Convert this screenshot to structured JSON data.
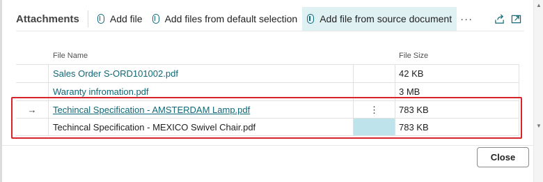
{
  "toolbar": {
    "title": "Attachments",
    "add_file": "Add file",
    "add_files_default": "Add files from default selection",
    "add_file_source": "Add file from source document",
    "more": "···",
    "share_icon": "share-icon",
    "expand_icon": "expand-icon"
  },
  "table": {
    "headers": {
      "file_name": "File Name",
      "file_size": "File Size"
    },
    "rows": [
      {
        "arrow": "",
        "name": "Sales Order S-ORD101002.pdf",
        "action": "",
        "size": "42 KB"
      },
      {
        "arrow": "",
        "name": "Waranty infromation.pdf",
        "action": "",
        "size": "3 MB"
      },
      {
        "arrow": "→",
        "name": "Techincal Specification - AMSTERDAM Lamp.pdf",
        "action": "⋮",
        "size": "783 KB"
      },
      {
        "arrow": "",
        "name": "Techincal Specification - MEXICO Swivel Chair.pdf",
        "action": "",
        "size": "783 KB"
      }
    ]
  },
  "footer": {
    "close_label": "Close"
  },
  "colors": {
    "accent": "#0e6877",
    "highlight": "#d9232b",
    "active_bg": "#e0f1f4",
    "selected_cell": "#bfe3ea"
  }
}
